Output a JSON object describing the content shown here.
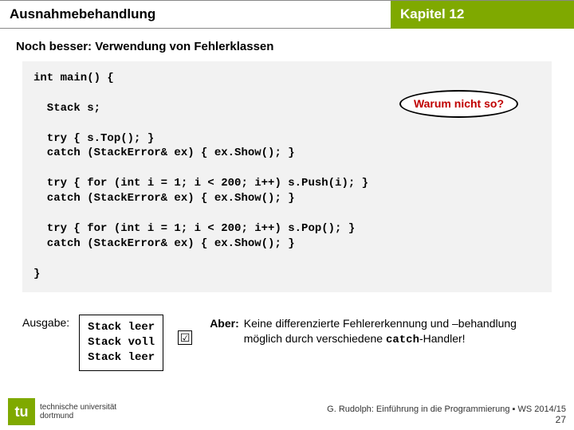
{
  "header": {
    "left": "Ausnahmebehandlung",
    "right": "Kapitel 12"
  },
  "subtitle": "Noch besser: Verwendung von Fehlerklassen",
  "callout": "Warum nicht so?",
  "code": {
    "l1": "int main() {",
    "l2": "  Stack s;",
    "l3": "  try { s.Top(); }",
    "l4": "  catch (StackError& ex) { ex.Show(); }",
    "l5": "  try { for (int i = 1; i < 200; i++) s.Push(i); }",
    "l6": "  catch (StackError& ex) { ex.Show(); }",
    "l7": "  try { for (int i = 1; i < 200; i++) s.Pop(); }",
    "l8": "  catch (StackError& ex) { ex.Show(); }",
    "l9": "}"
  },
  "output": {
    "label": "Ausgabe:",
    "lines": "Stack leer\nStack voll\nStack leer",
    "check": "☑"
  },
  "aber": {
    "label": "Aber:",
    "text_a": "Keine differenzierte Fehlererkennung und –behandlung möglich durch verschiedene ",
    "text_b": "catch",
    "text_c": "-Handler!"
  },
  "footer": {
    "tu_lines": "technische universität\ndortmund",
    "course": "G. Rudolph: Einführung in die Programmierung ▪ WS 2014/15",
    "slide": "27"
  }
}
